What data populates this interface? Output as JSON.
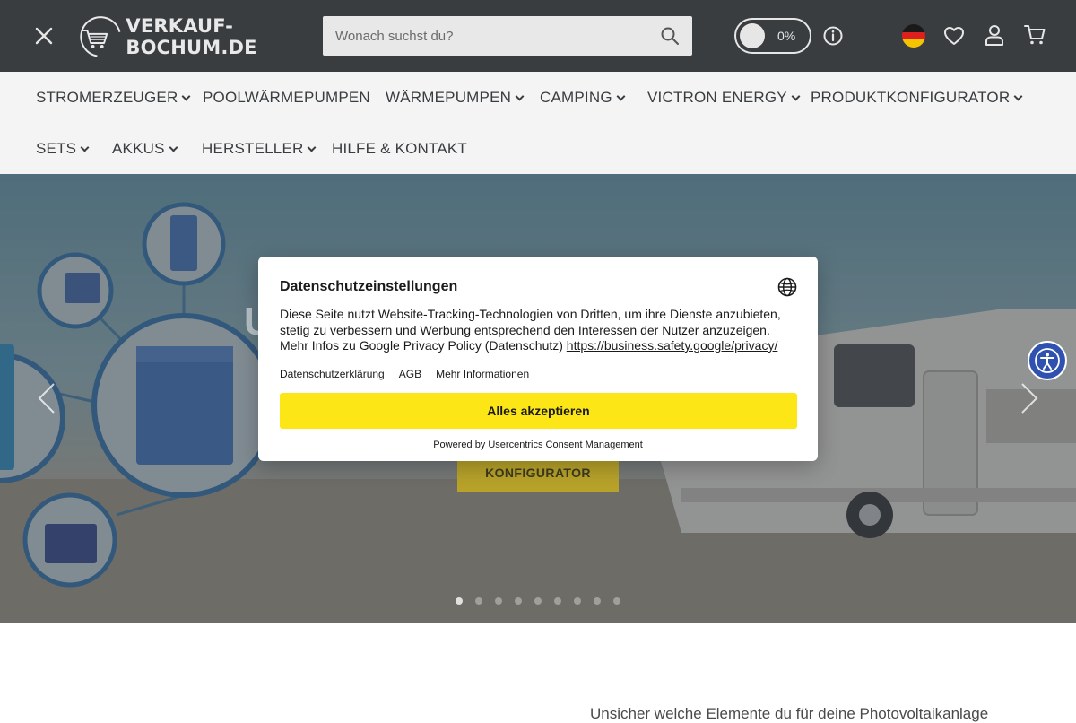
{
  "header": {
    "logo_text": "VERKAUF-BOCHUM.DE",
    "search_placeholder": "Wonach suchst du?",
    "toggle_label": "0%",
    "colors": {
      "background": "#3a3d40",
      "icon": "#e6e6e6"
    },
    "icons": [
      "close-icon",
      "search-icon",
      "info-icon",
      "germany-flag-icon",
      "heart-icon",
      "user-icon",
      "cart-icon"
    ]
  },
  "nav": {
    "items": [
      {
        "label": "STROMERZEUGER",
        "dropdown": true
      },
      {
        "label": "POOLWÄRMEPUMPEN",
        "dropdown": false
      },
      {
        "label": "WÄRMEPUMPEN",
        "dropdown": true
      },
      {
        "label": "CAMPING",
        "dropdown": true
      },
      {
        "label": "VICTRON ENERGY",
        "dropdown": true
      },
      {
        "label": "PRODUKTKONFIGURATOR",
        "dropdown": true
      },
      {
        "label": "SETS",
        "dropdown": true
      },
      {
        "label": "AKKUS",
        "dropdown": true
      },
      {
        "label": "HERSTELLER",
        "dropdown": true
      },
      {
        "label": "HILFE & KONTAKT",
        "dropdown": false
      }
    ]
  },
  "hero": {
    "cta_label": "KONFIGURATOR",
    "slide_count": 9,
    "active_slide": 1
  },
  "below": {
    "text": "Unsicher welche Elemente du für deine Photovoltaikanlage"
  },
  "consent": {
    "title": "Datenschutzeinstellungen",
    "body": "Diese Seite nutzt Website-Tracking-Technologien von Dritten, um ihre Dienste anzubieten, stetig zu verbessern und Werbung entsprechend den Interessen der Nutzer anzuzeigen. Mehr Infos zu Google Privacy Policy (Datenschutz)",
    "privacy_link": "https://business.safety.google/privacy/",
    "links": [
      "Datenschutzerklärung",
      "AGB",
      "Mehr Informationen"
    ],
    "accept_label": "Alles akzeptieren",
    "powered_by": "Powered by Usercentrics Consent Management",
    "accent": "#fce615"
  }
}
